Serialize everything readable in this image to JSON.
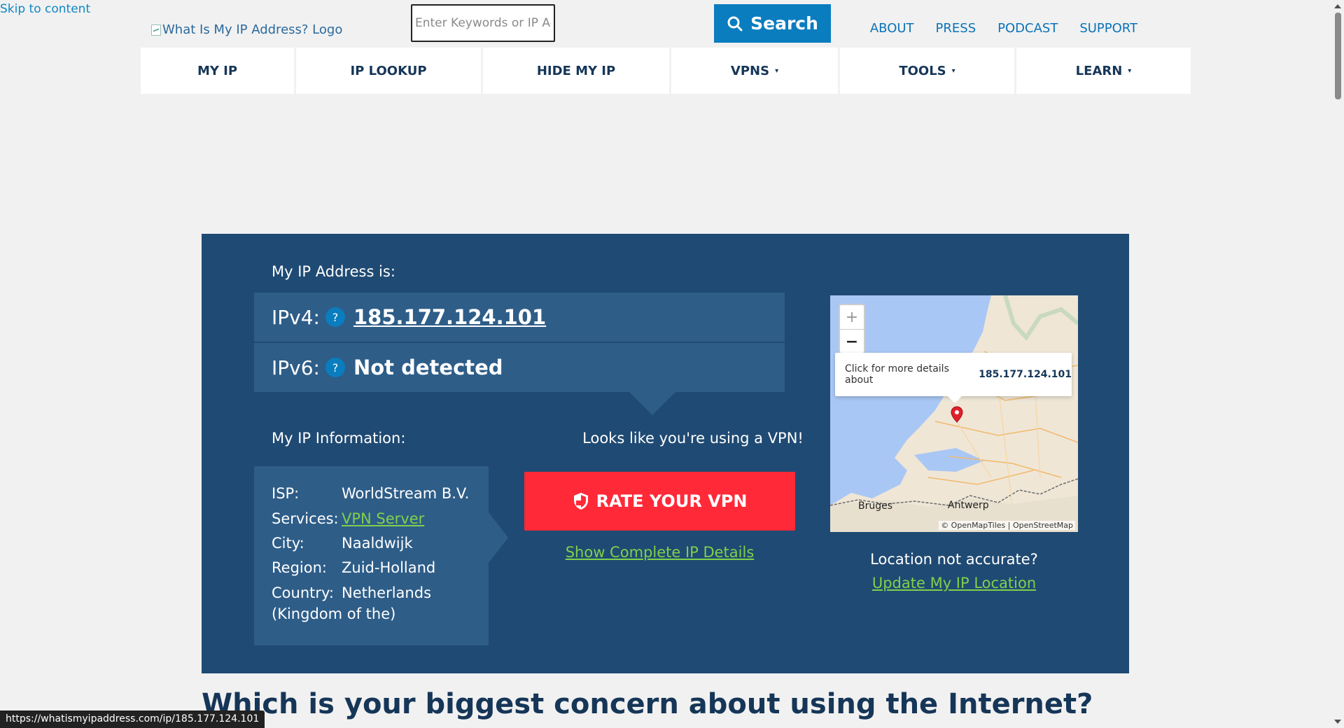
{
  "skip_link": "Skip to content",
  "header": {
    "logo_alt": "What Is My IP Address? Logo",
    "search_placeholder": "Enter Keywords or IP Address",
    "search_button": "Search",
    "top_links": [
      "ABOUT",
      "PRESS",
      "PODCAST",
      "SUPPORT"
    ]
  },
  "nav": {
    "items": [
      {
        "label": "MY IP",
        "has_dropdown": false
      },
      {
        "label": "IP LOOKUP",
        "has_dropdown": false
      },
      {
        "label": "HIDE MY IP",
        "has_dropdown": false
      },
      {
        "label": "VPNS",
        "has_dropdown": true
      },
      {
        "label": "TOOLS",
        "has_dropdown": true
      },
      {
        "label": "LEARN",
        "has_dropdown": true
      }
    ],
    "caret": "▾"
  },
  "hero": {
    "ip_heading": "My IP Address is:",
    "ipv4_label": "IPv4:",
    "ipv4_value": "185.177.124.101",
    "ipv6_label": "IPv6:",
    "ipv6_value": "Not detected",
    "help_glyph": "?",
    "info_heading": "My IP Information:",
    "info": {
      "isp_key": "ISP:",
      "isp_val": "WorldStream B.V.",
      "services_key": "Services:",
      "services_val": "VPN Server",
      "city_key": "City:",
      "city_val": "Naaldwijk",
      "region_key": "Region:",
      "region_val": "Zuid-Holland",
      "country_key": "Country:",
      "country_val": "Netherlands",
      "country_cont": "(Kingdom of the)"
    },
    "vpn_note": "Looks like you're using a VPN!",
    "rate_button": "RATE YOUR VPN",
    "details_link": "Show Complete IP Details",
    "map": {
      "zoom_in": "+",
      "zoom_out": "−",
      "popup_text": "Click for more details about",
      "popup_ip": "185.177.124.101",
      "label_bruges": "Bruges",
      "label_antwerp": "Antwerp",
      "attribution": "© OpenMapTiles | OpenStreetMap"
    },
    "loc_question": "Location not accurate?",
    "loc_link": "Update My IP Location"
  },
  "bottom_heading": "Which is your biggest concern about using the Internet?",
  "status_url": "https://whatismyipaddress.com/ip/185.177.124.101",
  "colors": {
    "hero_bg": "#1f4a73",
    "panel_bg": "#2e5d88",
    "accent_blue": "#0a7dbf",
    "cta_red": "#ff2938",
    "link_green": "#7fd04c"
  }
}
